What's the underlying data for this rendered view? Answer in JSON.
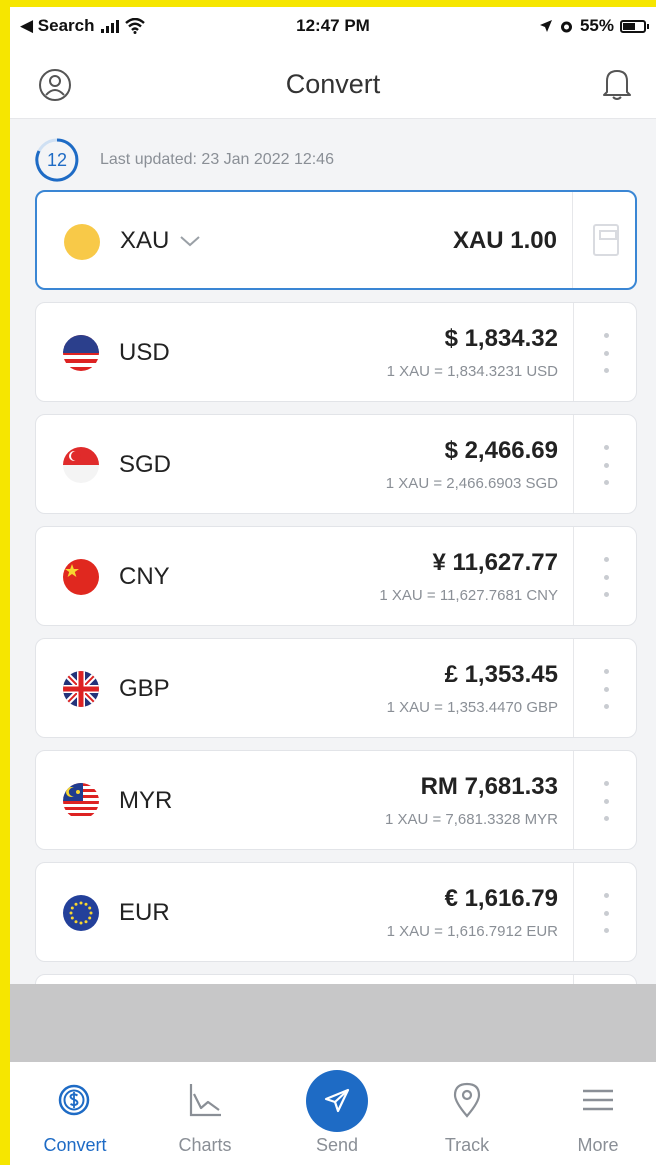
{
  "status_bar": {
    "back_label": "◀ Search",
    "time": "12:47 PM",
    "battery": "55%"
  },
  "header": {
    "title": "Convert"
  },
  "update": {
    "countdown": "12",
    "text": "Last updated: 23 Jan 2022 12:46"
  },
  "base": {
    "code": "XAU",
    "amount": "XAU 1.00",
    "color": "#f8c948"
  },
  "rates": [
    {
      "code": "USD",
      "amount": "$ 1,834.32",
      "rate": "1 XAU = 1,834.3231 USD",
      "flag": "usd-flag"
    },
    {
      "code": "SGD",
      "amount": "$ 2,466.69",
      "rate": "1 XAU = 2,466.6903 SGD",
      "flag": "sgd-flag"
    },
    {
      "code": "CNY",
      "amount": "¥ 11,627.77",
      "rate": "1 XAU = 11,627.7681 CNY",
      "flag": "cny-flag"
    },
    {
      "code": "GBP",
      "amount": "£ 1,353.45",
      "rate": "1 XAU = 1,353.4470 GBP",
      "flag": "gbp-flag"
    },
    {
      "code": "MYR",
      "amount": "RM 7,681.33",
      "rate": "1 XAU = 7,681.3328 MYR",
      "flag": "myr-flag"
    },
    {
      "code": "EUR",
      "amount": "€ 1,616.79",
      "rate": "1 XAU = 1,616.7912 EUR",
      "flag": "eur-flag"
    }
  ],
  "tabs": [
    {
      "label": "Convert",
      "icon": "convert-icon",
      "active": true
    },
    {
      "label": "Charts",
      "icon": "charts-icon"
    },
    {
      "label": "Send",
      "icon": "send-icon"
    },
    {
      "label": "Track",
      "icon": "track-icon"
    },
    {
      "label": "More",
      "icon": "menu-icon"
    }
  ],
  "colors": {
    "accent": "#1e6bc5",
    "base_border": "#3a86d4"
  }
}
